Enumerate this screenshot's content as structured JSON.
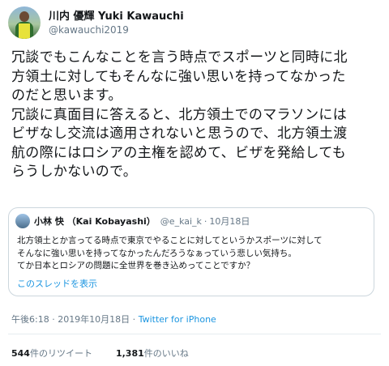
{
  "author": {
    "display_name": "川内 優輝 Yuki Kawauchi",
    "handle": "@kawauchi2019",
    "avatar_icon": "avatar-photo"
  },
  "tweet": {
    "lines": [
      "冗談でもこんなことを言う時点でスポーツと同時に北",
      "方領土に対してもそんなに強い思いを持ってなかった",
      "のだと思います。",
      "冗談に真面目に答えると、北方領土でのマラソンには",
      "ビザなし交流は適用されないと思うので、北方領土渡",
      "航の際にはロシアの主権を認めて、ビザを発給しても",
      "らうしかないので。"
    ]
  },
  "quote": {
    "name": "小林 快 （Kai Kobayashi）",
    "handle": "@e_kai_k",
    "separator": "·",
    "date": "10月18日",
    "lines": [
      "北方領土とか言ってる時点で東京でやることに対してというかスポーツに対して",
      "そんなに強い思いを持ってなかったんだろうなぁっていう悲しい気持ち。",
      "てか日本とロシアの問題に全世界を巻き込めってことですか？"
    ],
    "thread_link": "このスレッドを表示"
  },
  "meta": {
    "timestamp": "午後6:18 · 2019年10月18日 ·",
    "source": "Twitter for iPhone"
  },
  "stats": {
    "retweets_count": "544",
    "retweets_label": "件のリツイート",
    "likes_count": "1,381",
    "likes_label": "件のいいね"
  },
  "colors": {
    "link": "#1b95e0",
    "secondary_text": "#657786",
    "border": "#ccd6dd"
  }
}
